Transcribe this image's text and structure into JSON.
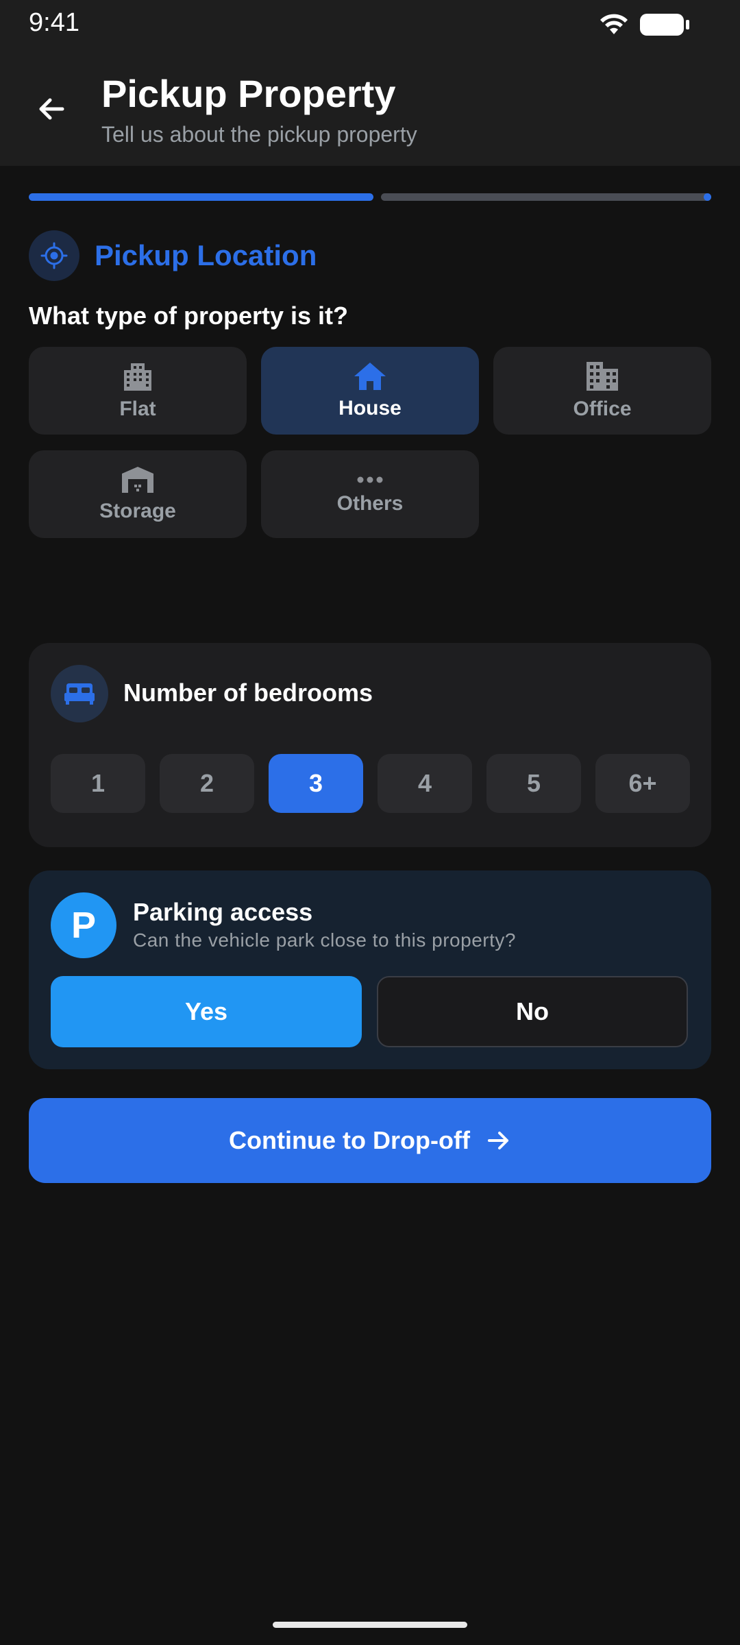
{
  "status_bar": {
    "time": "9:41"
  },
  "header": {
    "title": "Pickup Property",
    "subtitle": "Tell us about the pickup property"
  },
  "progress": {
    "current_step": 1,
    "total_steps": 2
  },
  "section": {
    "title": "Pickup Location",
    "icon": "location-target-icon"
  },
  "property_type": {
    "question": "What type of property is it?",
    "options": [
      {
        "label": "Flat",
        "icon": "building-icon",
        "selected": false
      },
      {
        "label": "House",
        "icon": "house-icon",
        "selected": true
      },
      {
        "label": "Office",
        "icon": "office-icon",
        "selected": false
      },
      {
        "label": "Storage",
        "icon": "warehouse-icon",
        "selected": false
      },
      {
        "label": "Others",
        "icon": "more-horizontal-icon",
        "selected": false
      }
    ]
  },
  "bedrooms": {
    "title": "Number of bedrooms",
    "icon": "bed-icon",
    "options": [
      "1",
      "2",
      "3",
      "4",
      "5",
      "6+"
    ],
    "selected": "3"
  },
  "parking": {
    "badge": "P",
    "title": "Parking access",
    "subtitle": "Can the vehicle park close to this property?",
    "yes_label": "Yes",
    "no_label": "No",
    "selected": "Yes"
  },
  "actions": {
    "continue_label": "Continue to Drop-off"
  },
  "colors": {
    "accent": "#2c6fe8",
    "parking_accent": "#2196f3",
    "background": "#121212",
    "surface": "#1e1e1e"
  }
}
